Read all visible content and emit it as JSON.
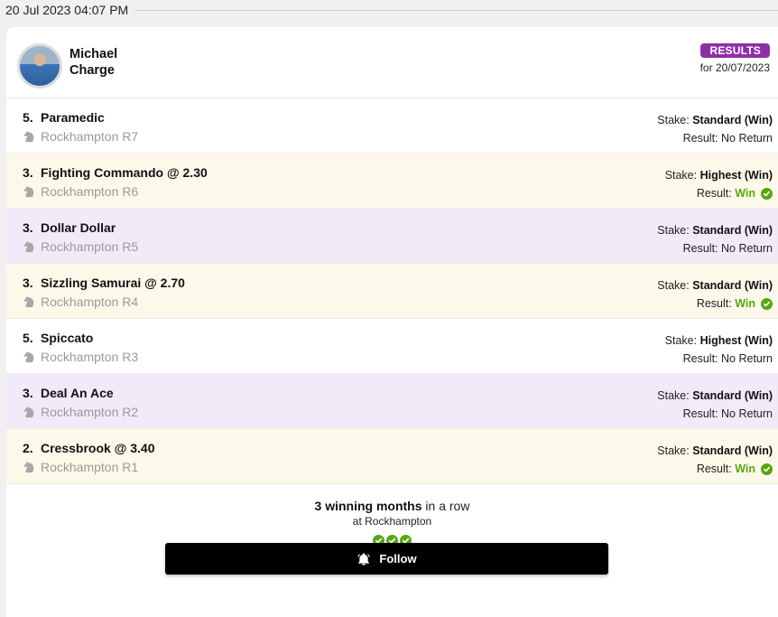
{
  "timestamp": "20 Jul 2023 04:07 PM",
  "tipster": {
    "first_name": "Michael",
    "last_name": "Charge"
  },
  "badge": {
    "label": "RESULTS",
    "color": "#8e2fa5"
  },
  "results_for": "for 20/07/2023",
  "stake_label": "Stake:",
  "result_label": "Result:",
  "tips": [
    {
      "position": "5.",
      "selection": "Paramedic",
      "race": "Rockhampton R7",
      "stake": "Standard (Win)",
      "result": "No Return",
      "won": false,
      "bg": "white"
    },
    {
      "position": "3.",
      "selection": "Fighting Commando @ 2.30",
      "race": "Rockhampton R6",
      "stake": "Highest (Win)",
      "result": "Win",
      "won": true,
      "bg": "yellow"
    },
    {
      "position": "3.",
      "selection": "Dollar Dollar",
      "race": "Rockhampton R5",
      "stake": "Standard (Win)",
      "result": "No Return",
      "won": false,
      "bg": "purple"
    },
    {
      "position": "3.",
      "selection": "Sizzling Samurai @ 2.70",
      "race": "Rockhampton R4",
      "stake": "Standard (Win)",
      "result": "Win",
      "won": true,
      "bg": "yellow"
    },
    {
      "position": "5.",
      "selection": "Spiccato",
      "race": "Rockhampton R3",
      "stake": "Highest (Win)",
      "result": "No Return",
      "won": false,
      "bg": "white"
    },
    {
      "position": "3.",
      "selection": "Deal An Ace",
      "race": "Rockhampton R2",
      "stake": "Standard (Win)",
      "result": "No Return",
      "won": false,
      "bg": "purple"
    },
    {
      "position": "2.",
      "selection": "Cressbrook @ 3.40",
      "race": "Rockhampton R1",
      "stake": "Standard (Win)",
      "result": "Win",
      "won": true,
      "bg": "yellow"
    }
  ],
  "streak": {
    "bold": "3 winning months",
    "rest": " in a row",
    "location": "at Rockhampton",
    "count": 3
  },
  "follow_button": {
    "label": "Follow",
    "icon": "bell-icon"
  },
  "colors": {
    "win": "#5aa512",
    "badge": "#8e2fa5"
  }
}
